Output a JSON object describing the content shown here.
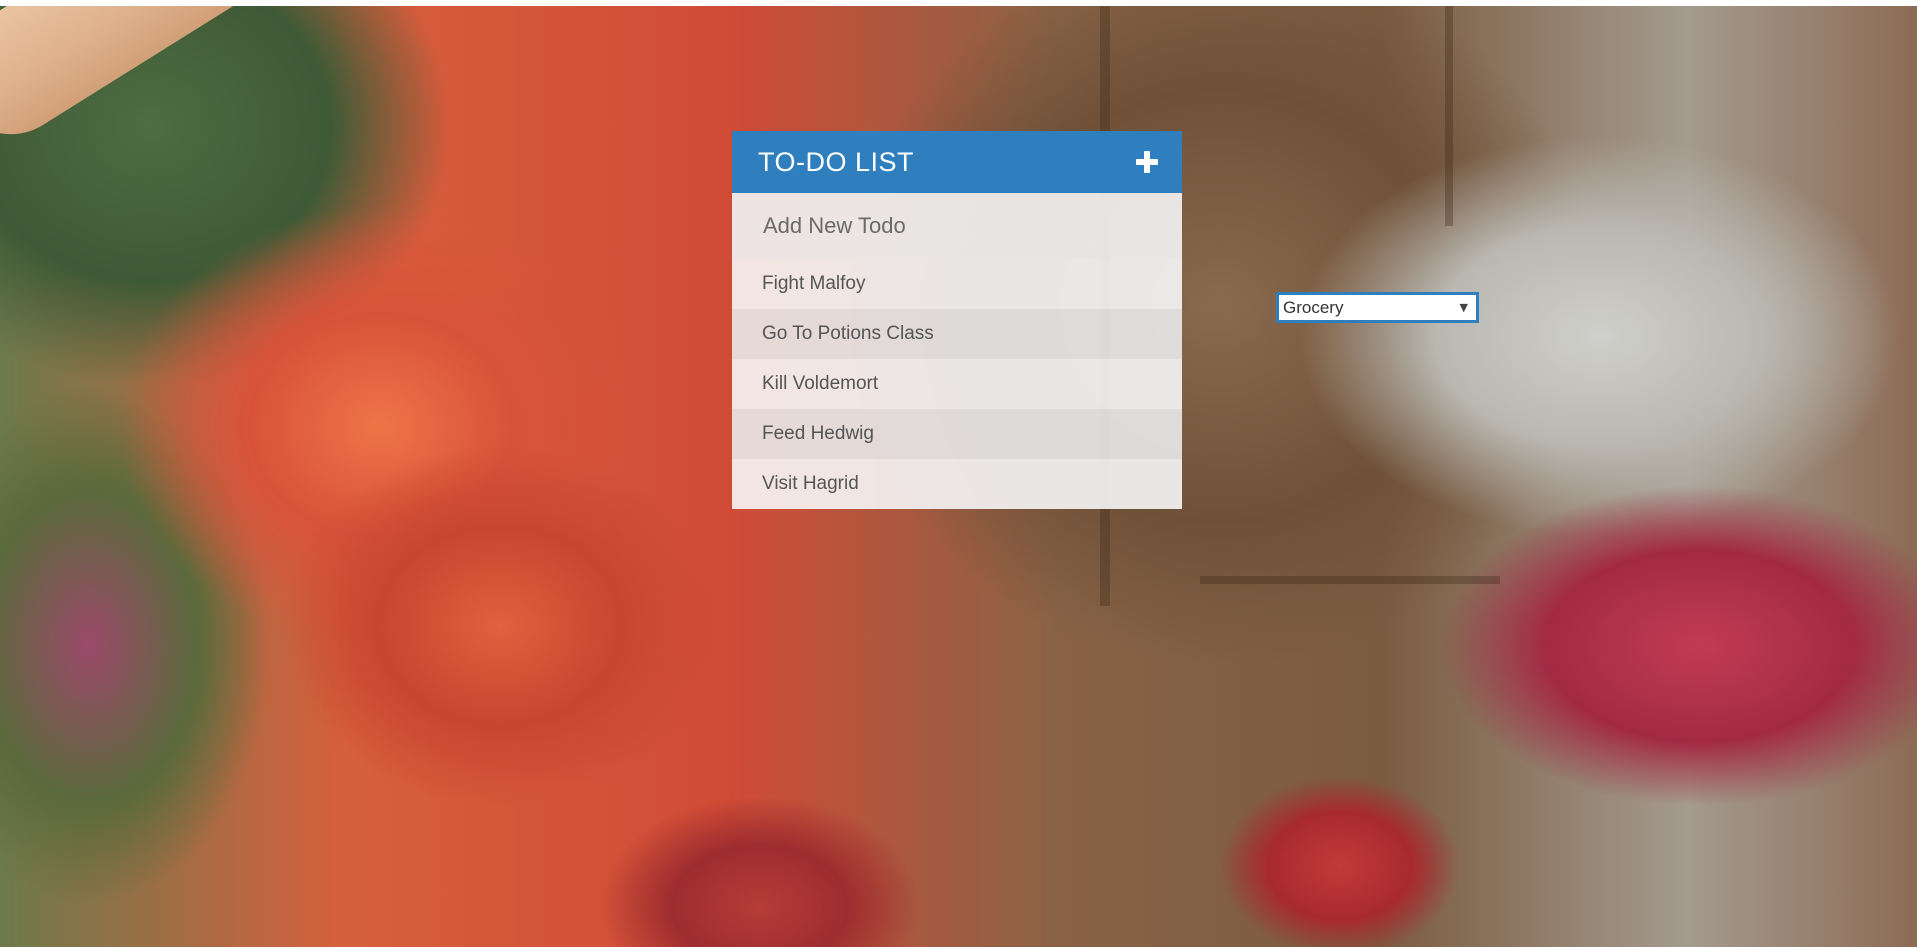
{
  "todo": {
    "title": "TO-DO LIST",
    "add_button_icon": "plus-icon",
    "input_placeholder": "Add New Todo",
    "items": [
      {
        "label": "Fight Malfoy"
      },
      {
        "label": "Go To Potions Class"
      },
      {
        "label": "Kill Voldemort"
      },
      {
        "label": "Feed Hedwig"
      },
      {
        "label": "Visit Hagrid"
      }
    ]
  },
  "category_select": {
    "selected": "Grocery",
    "icon": "chevron-down-icon"
  },
  "colors": {
    "accent": "#2f7fbe",
    "text": "#555555"
  }
}
